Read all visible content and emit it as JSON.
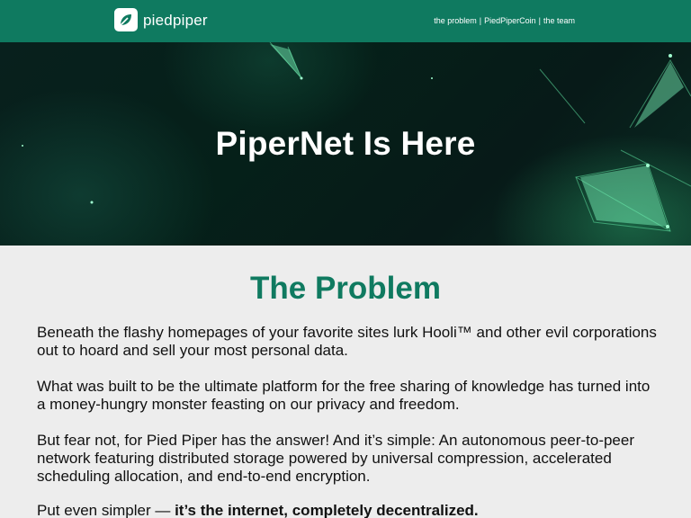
{
  "header": {
    "brand": "piedpiper",
    "nav": [
      {
        "label": "the problem"
      },
      {
        "label": "PiedPiperCoin"
      },
      {
        "label": "the team"
      }
    ],
    "separator": "|"
  },
  "hero": {
    "title": "PiperNet Is Here"
  },
  "main": {
    "title": "The Problem",
    "paragraphs": [
      "Beneath the flashy homepages of your favorite sites lurk Hooli™ and other evil corporations out to hoard and sell your most personal data.",
      "What was built to be the ultimate platform for the free sharing of knowledge has turned into a money-hungry monster feasting on our privacy and freedom.",
      "But fear not, for Pied Piper has the answer! And it’s simple: An autonomous peer-to-peer network featuring distributed storage powered by universal compression, accelerated scheduling allocation, and end-to-end encryption."
    ],
    "last_paragraph": {
      "lead": "Put even simpler — ",
      "emphasis": "it’s the internet, completely decentralized."
    }
  },
  "colors": {
    "brand_green": "#0f7a60",
    "page_background": "#ededed",
    "hero_background": "#06211c"
  },
  "icons": {
    "brand": "leaf-icon"
  }
}
